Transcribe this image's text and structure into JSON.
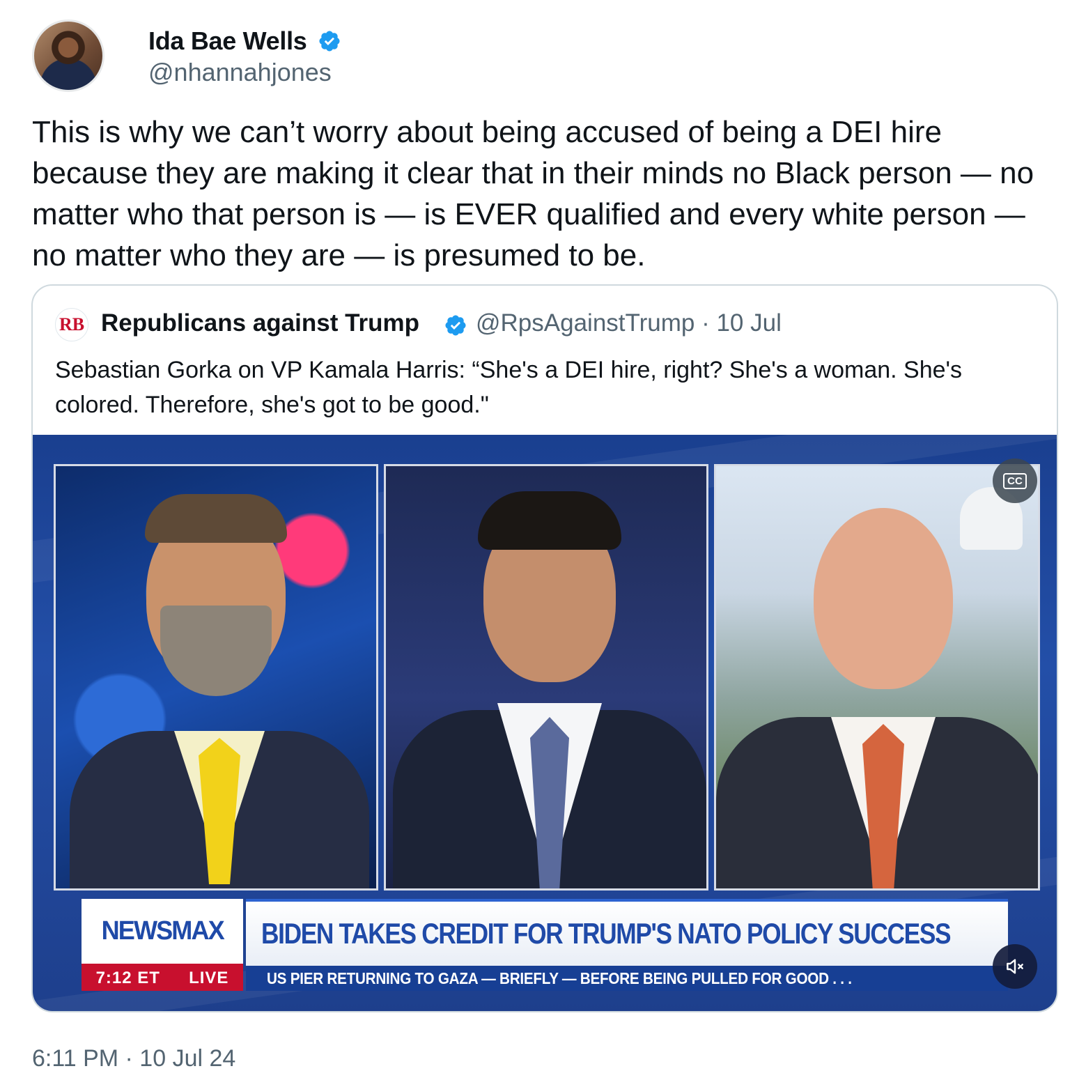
{
  "author": {
    "display_name": "Ida Bae Wells",
    "handle": "@nhannahjones",
    "verified": true
  },
  "tweet": {
    "text": "This is why we can’t worry about being accused of being a DEI hire because they are making it clear that in their minds no Black person — no matter who that person is — is EVER qualified and every white person — no matter who they are — is presumed to be.",
    "timestamp": "6:11 PM · 10 Jul 24"
  },
  "quote": {
    "avatar_text": "RB",
    "display_name": "Republicans against Trump",
    "handle": "@RpsAgainstTrump",
    "separator": "·",
    "date": "10 Jul",
    "text": "Sebastian Gorka on VP Kamala Harris: “She's a DEI hire, right? She's a woman. She's colored. Therefore, she's got to be good.\"",
    "video": {
      "brand": "NEWSMAX",
      "headline": "BIDEN TAKES CREDIT FOR TRUMP'S NATO POLICY SUCCESS",
      "time": "7:12 ET",
      "live": "LIVE",
      "ticker": "US PIER RETURNING TO GAZA — BRIEFLY — BEFORE BEING PULLED FOR GOOD . . .",
      "cc_label": "CC"
    }
  },
  "icons": {
    "verified": "verified-badge-icon",
    "captions": "closed-captions-icon",
    "mute": "speaker-muted-icon"
  },
  "colors": {
    "verified_blue": "#1d9bf0",
    "secondary_text": "#536471",
    "newsmax_blue": "#1f4aa8",
    "newsmax_red": "#c8102e"
  }
}
